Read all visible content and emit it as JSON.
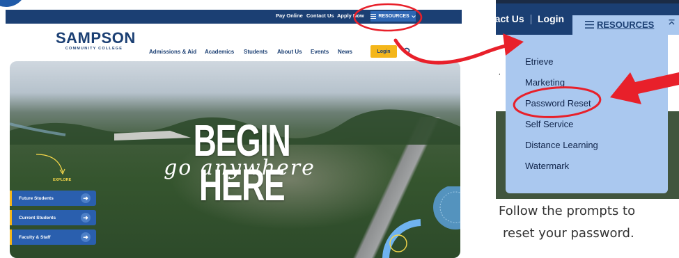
{
  "website": {
    "topbar": {
      "links": [
        "Pay Online",
        "Contact Us",
        "Apply Now"
      ],
      "resources_label": "RESOURCES"
    },
    "logo": {
      "name": "SAMPSON",
      "subtitle": "COMMUNITY COLLEGE"
    },
    "nav": {
      "items": [
        "Admissions & Aid",
        "Academics",
        "Students",
        "About Us",
        "Events",
        "News"
      ],
      "login_label": "Login"
    },
    "hero": {
      "title": "BEGIN HERE",
      "subtitle": "go anywhere",
      "explore_label": "EXPLORE",
      "buttons": [
        "Future Students",
        "Current Students",
        "Faculty & Staff"
      ]
    }
  },
  "zoomed_menu": {
    "contact_label": "tact Us",
    "login_label": "Login",
    "resources_label": "RESOURCES",
    "items": [
      "Etrieve",
      "Marketing",
      "Password Reset",
      "Self Service",
      "Distance Learning",
      "Watermark"
    ],
    "highlighted_item": "Password Reset"
  },
  "caption": {
    "line1": "Follow the prompts to",
    "line2": "reset your password."
  },
  "colors": {
    "navy": "#1b3f73",
    "dropdown_blue": "#aac8ef",
    "login_yellow": "#f4b61a",
    "annotation_red": "#e8202a",
    "button_blue": "#2a5fae"
  },
  "icons": [
    "hamburger-icon",
    "chevron-down-icon",
    "chevron-up-icon",
    "search-icon",
    "arrow-right-icon"
  ]
}
